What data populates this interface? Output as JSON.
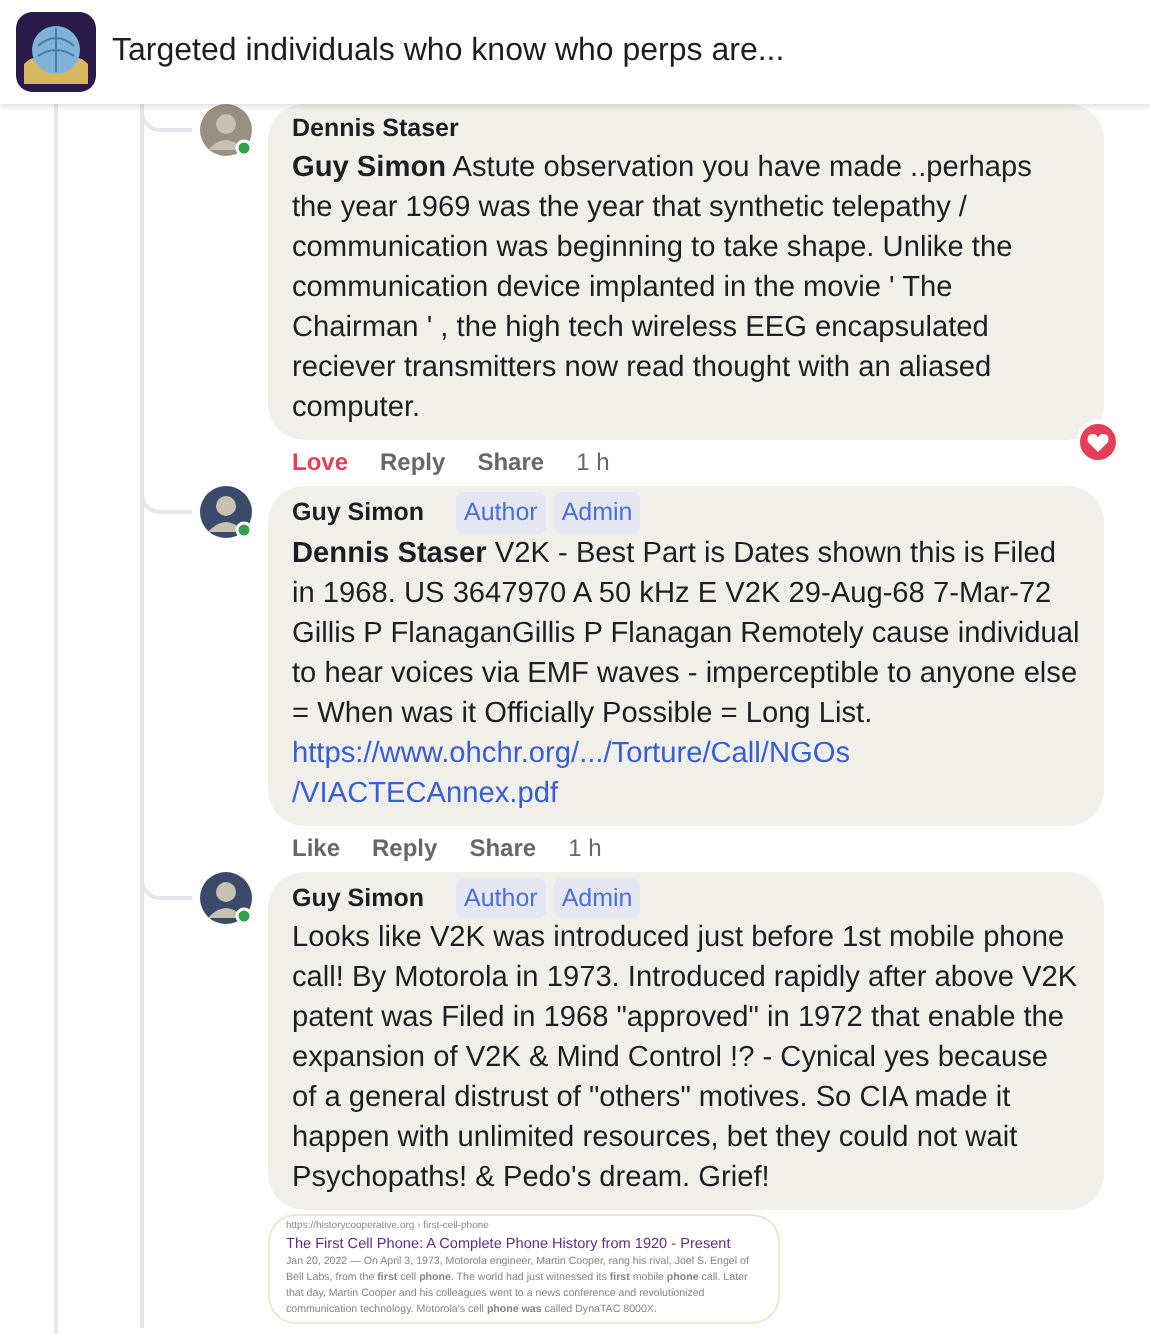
{
  "header": {
    "title": "Targeted individuals who know who perps are..."
  },
  "comments": [
    {
      "author": "Dennis Staser",
      "text": "**Guy Simon** Astute observation you have made ..perhaps the year 1969 was the year that synthetic telepathy / communication was beginning to take shape. Unlike the communication device implanted in the movie ' The Chairman ' , the high tech wireless EEG encapsulated reciever transmitters now read thought with an aliased computer.",
      "loved": true,
      "actions": [
        {
          "label": "Love",
          "kind": "react",
          "selected": true
        },
        {
          "label": "Reply",
          "kind": "plain"
        },
        {
          "label": "Share",
          "kind": "plain"
        }
      ],
      "time": "1 h"
    },
    {
      "author": "Guy Simon",
      "badges": [
        "Author",
        "Admin"
      ],
      "text": "**Dennis Staser** V2K - Best Part is Dates shown this is Filed in 1968. US 3647970 A 50 kHz E V2K 29-Aug-68 7-Mar-72 Gillis P FlanaganGillis P Flanagan Remotely cause individual to hear voices via EMF waves - imperceptible to anyone else = When was it Officially Possible = Long List.",
      "link": [
        "https://www.ohchr.org/.../Torture/Call/NGOs",
        "/VIACTECAnnex.pdf"
      ],
      "actions": [
        {
          "label": "Like",
          "kind": "react",
          "selected": false
        },
        {
          "label": "Reply",
          "kind": "plain"
        },
        {
          "label": "Share",
          "kind": "plain"
        }
      ],
      "time": "1 h"
    },
    {
      "author": "Guy Simon",
      "badges": [
        "Author",
        "Admin"
      ],
      "text": "Looks like V2K was introduced just before 1st mobile phone call! By Motorola in 1973. Introduced rapidly after above V2K patent was Filed in 1968 \"approved\" in 1972 that enable the expansion of V2K & Mind Control !? - Cynical yes because of a general distrust of \"others\" motives. So CIA made it happen with unlimited resources, bet they could not wait Psychopaths! & Pedo's dream. Grief!",
      "attachment": {
        "url": "https://historycooperative.org › first-cell-phone",
        "title": "The First Cell Phone: A Complete Phone History from 1920 - Present",
        "date": "Jan 20, 2022",
        "snippet": "— On April 3, 1973, Motorola engineer, Martin Cooper, rang his rival, Joel S. Engel of Bell Labs, from the **first** cell **phone**. The world had just witnessed its **first** mobile **phone** call. Later that day, Martin Cooper and his colleagues went to a news conference and revolutionized communication technology. Motorola's cell **phone was** called DynaTAC 8000X."
      }
    }
  ]
}
